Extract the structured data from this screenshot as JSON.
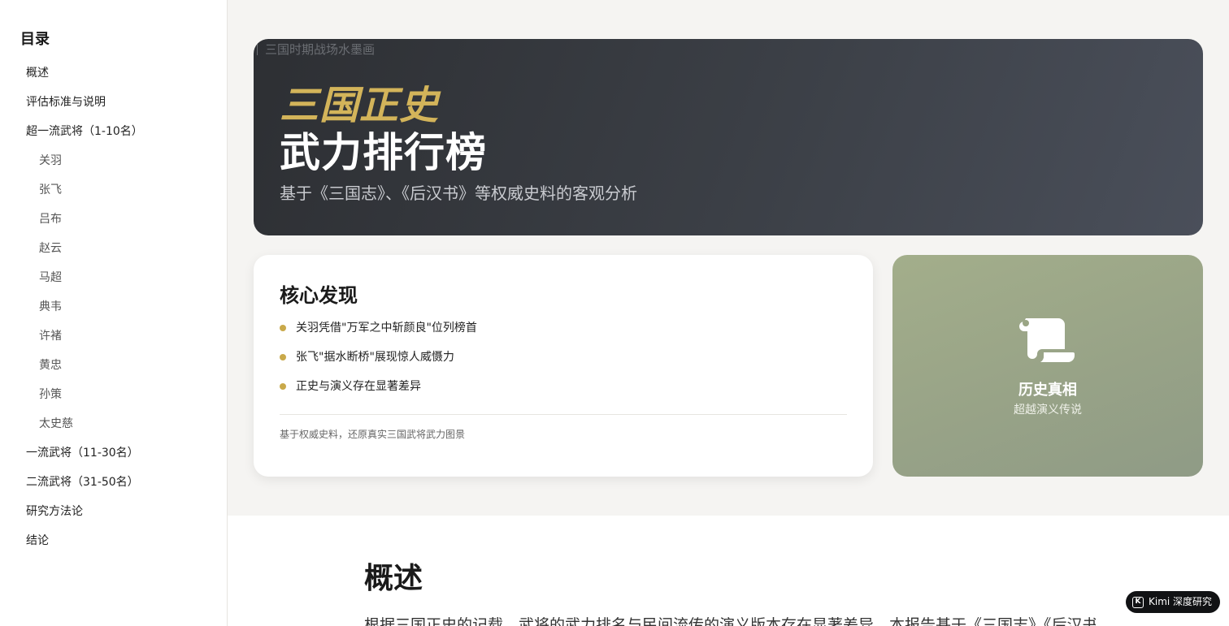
{
  "sidebar": {
    "title": "目录",
    "items": [
      {
        "label": "概述",
        "level": 1
      },
      {
        "label": "评估标准与说明",
        "level": 1
      },
      {
        "label": "超一流武将（1-10名）",
        "level": 1
      },
      {
        "label": "关羽",
        "level": 2
      },
      {
        "label": "张飞",
        "level": 2
      },
      {
        "label": "吕布",
        "level": 2
      },
      {
        "label": "赵云",
        "level": 2
      },
      {
        "label": "马超",
        "level": 2
      },
      {
        "label": "典韦",
        "level": 2
      },
      {
        "label": "许褚",
        "level": 2
      },
      {
        "label": "黄忠",
        "level": 2
      },
      {
        "label": "孙策",
        "level": 2
      },
      {
        "label": "太史慈",
        "level": 2
      },
      {
        "label": "一流武将（11-30名）",
        "level": 1
      },
      {
        "label": "二流武将（31-50名）",
        "level": 1
      },
      {
        "label": "研究方法论",
        "level": 1
      },
      {
        "label": "结论",
        "level": 1
      }
    ]
  },
  "hero": {
    "image_alt": "三国时期战场水墨画",
    "title_line1": "三国正史",
    "title_line2": "武力排行榜",
    "subtitle": "基于《三国志》、《后汉书》等权威史料的客观分析"
  },
  "findings": {
    "title": "核心发现",
    "items": [
      "关羽凭借\"万军之中斩颜良\"位列榜首",
      "张飞\"据水断桥\"展现惊人威慑力",
      "正史与演义存在显著差异"
    ],
    "footnote": "基于权威史料，还原真实三国武将武力图景"
  },
  "truth_card": {
    "icon": "scroll-icon",
    "title": "历史真相",
    "subtitle": "超越演义传说"
  },
  "section": {
    "title": "概述",
    "text": "根据三国正史的记载，武将的武力排名与民间流传的演义版本存在显著差异。本报告基于《三国志》《后汉书》"
  },
  "badge": {
    "logo": "K",
    "label": "Kimi 深度研究"
  },
  "colors": {
    "accent_gold": "#c9a94a",
    "sage": "#9aa585",
    "hero_dark": "#3a3d43"
  }
}
